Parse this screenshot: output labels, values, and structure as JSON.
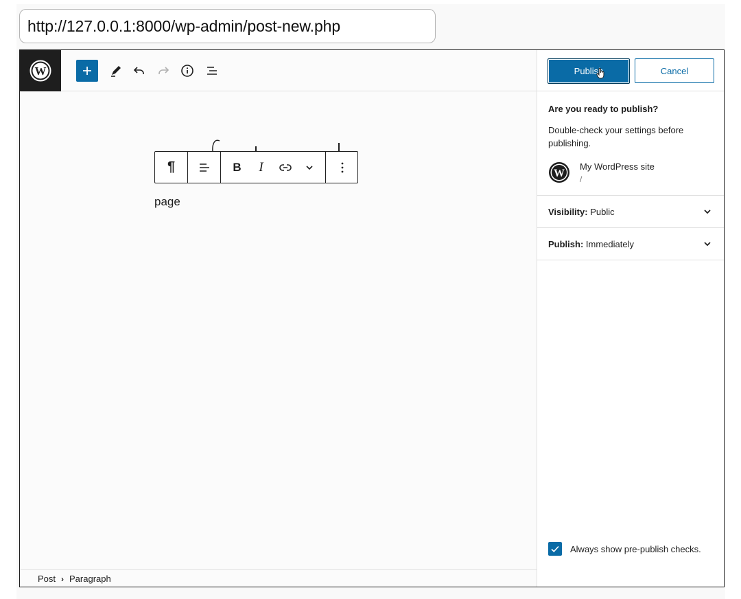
{
  "browser": {
    "url": "http://127.0.0.1:8000/wp-admin/post-new.php"
  },
  "toolbar": {
    "icons": [
      "wordpress-icon",
      "plus-icon",
      "pencil-icon",
      "undo-icon",
      "redo-icon",
      "info-icon",
      "list-view-icon"
    ]
  },
  "block_toolbar": {
    "icons": [
      "pilcrow-icon",
      "align-left-icon",
      "bold-icon",
      "italic-icon",
      "link-icon",
      "chevron-down-icon",
      "more-vertical-icon"
    ]
  },
  "editor": {
    "paragraph_text": "page"
  },
  "breadcrumb": {
    "items": [
      "Post",
      "Paragraph"
    ]
  },
  "sidebar": {
    "publish_label": "Publish",
    "cancel_label": "Cancel",
    "title": "Are you ready to publish?",
    "description": "Double-check your settings before publishing.",
    "site_name": "My WordPress site",
    "site_url": "/",
    "panels": [
      {
        "label": "Visibility:",
        "value": "Public"
      },
      {
        "label": "Publish:",
        "value": "Immediately"
      }
    ],
    "checkbox_label": "Always show pre-publish checks.",
    "checkbox_checked": true
  },
  "colors": {
    "accent": "#0a6ba6",
    "dark": "#1e1e1e"
  }
}
